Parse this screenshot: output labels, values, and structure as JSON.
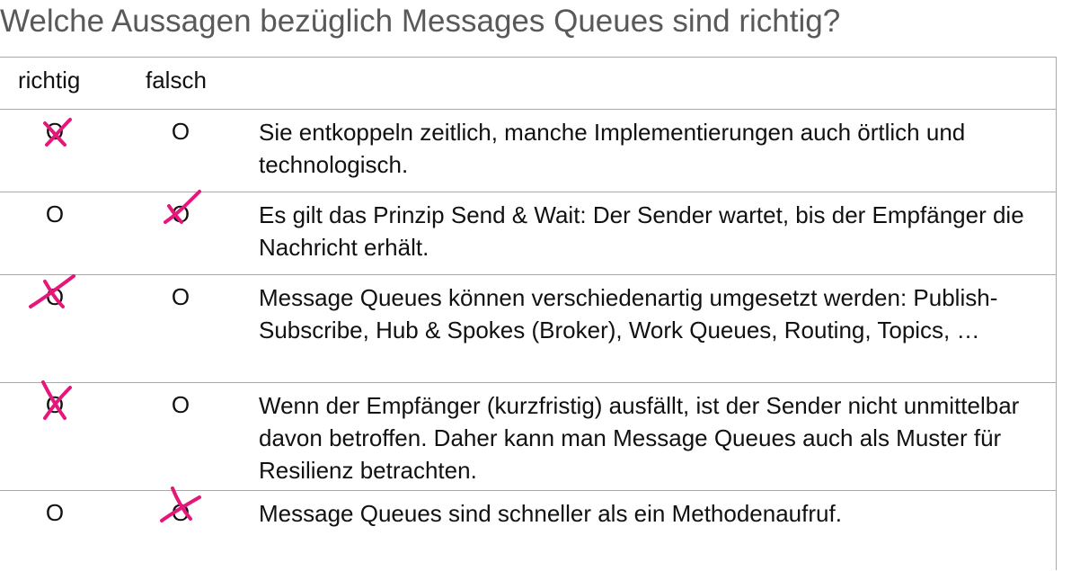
{
  "title": "Welche Aussagen bezüglich Messages Queues sind richtig?",
  "header": {
    "col_richtig": "richtig",
    "col_falsch": "falsch"
  },
  "option_symbol": "O",
  "mark_color": "#e6177a",
  "rows": [
    {
      "text": "Sie entkoppeln zeitlich, manche Implementierungen auch örtlich und technologisch.",
      "marked": "richtig"
    },
    {
      "text": "Es gilt das Prinzip Send & Wait: Der Sender wartet, bis der Empfänger die Nachricht erhält.",
      "marked": "falsch"
    },
    {
      "text": "Message Queues können verschiedenartig umgesetzt werden: Publish-Subscribe, Hub & Spokes (Broker), Work Queues, Routing, Topics, …",
      "marked": "richtig"
    },
    {
      "text": "Wenn der Empfänger (kurzfristig) ausfällt, ist der Sender nicht unmittelbar davon betroffen. Daher kann man Message Queues auch als Muster für Resilienz betrachten.",
      "marked": "richtig"
    },
    {
      "text": "Message Queues sind schneller als ein Methodenaufruf.",
      "marked": "falsch"
    }
  ]
}
